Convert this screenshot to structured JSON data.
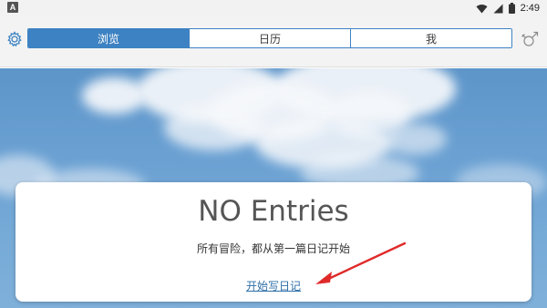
{
  "status_bar": {
    "left_icon": "A",
    "time": "2:49",
    "icons": [
      "wifi-icon",
      "signal-icon",
      "battery-icon"
    ]
  },
  "toolbar": {
    "settings_icon": "gear-icon",
    "gender_icon": "gender-icon",
    "tabs": [
      {
        "label": "浏览",
        "active": true
      },
      {
        "label": "日历",
        "active": false
      },
      {
        "label": "我",
        "active": false
      }
    ]
  },
  "empty_state": {
    "title": "NO Entries",
    "subtitle": "所有冒险，都从第一篇日记开始",
    "link": "开始写日记"
  },
  "colors": {
    "accent": "#3d82c2",
    "annotation_arrow": "#e02a2a"
  }
}
